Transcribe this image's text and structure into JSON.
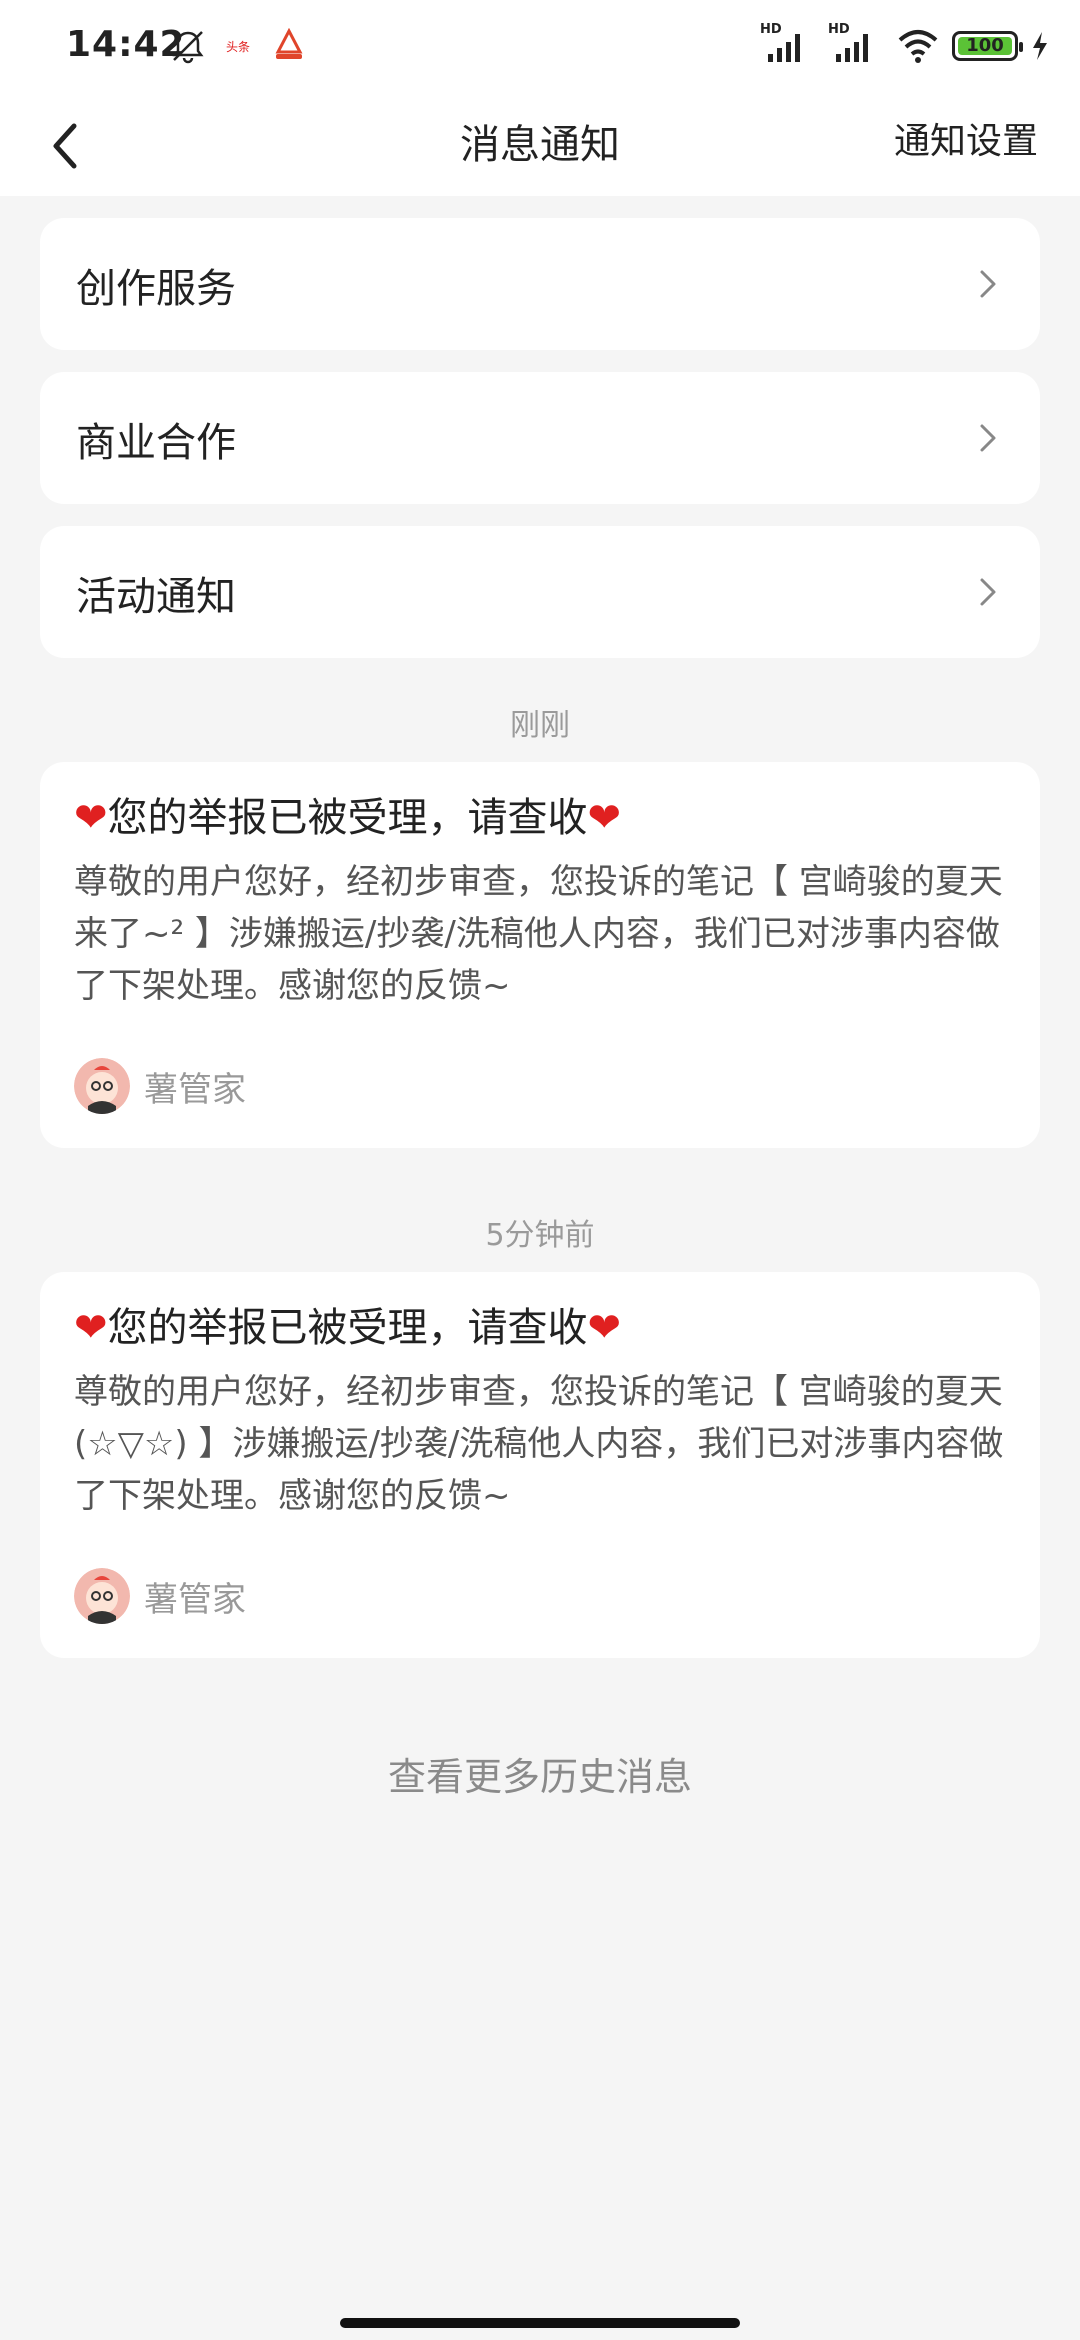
{
  "status_bar": {
    "time": "14:42",
    "mute_icon": "bell-off-icon",
    "app_icon_1": "toutiao-app-icon",
    "app_icon_1_text": "头条",
    "app_icon_2": "app-notification-icon",
    "signal_label": "HD",
    "wifi_icon": "wifi-icon",
    "battery_level": "100",
    "charging_icon": "bolt-icon"
  },
  "nav": {
    "back_icon": "chevron-left-icon",
    "title": "消息通知",
    "settings_label": "通知设置"
  },
  "menu": [
    {
      "label": "创作服务"
    },
    {
      "label": "商业合作"
    },
    {
      "label": "活动通知"
    }
  ],
  "messages": [
    {
      "time": "刚刚",
      "title_prefix": "❤",
      "title": "您的举报已被受理，请查收",
      "title_suffix": "❤",
      "body": "尊敬的用户您好，经初步审查，您投诉的笔记【 宫崎骏的夏天来了~² 】涉嫌搬运/抄袭/洗稿他人内容，我们已对涉事内容做了下架处理。感谢您的反馈~",
      "sender": "薯管家"
    },
    {
      "time": "5分钟前",
      "title_prefix": "❤",
      "title": "您的举报已被受理，请查收",
      "title_suffix": "❤",
      "body": "尊敬的用户您好，经初步审查，您投诉的笔记【 宫崎骏的夏天(☆▽☆) 】涉嫌搬运/抄袭/洗稿他人内容，我们已对涉事内容做了下架处理。感谢您的反馈~",
      "sender": "薯管家"
    }
  ],
  "footer": {
    "more_history": "查看更多历史消息"
  },
  "colors": {
    "heart": "#e02020",
    "battery_fill": "#5bc236",
    "background": "#f5f5f5"
  }
}
